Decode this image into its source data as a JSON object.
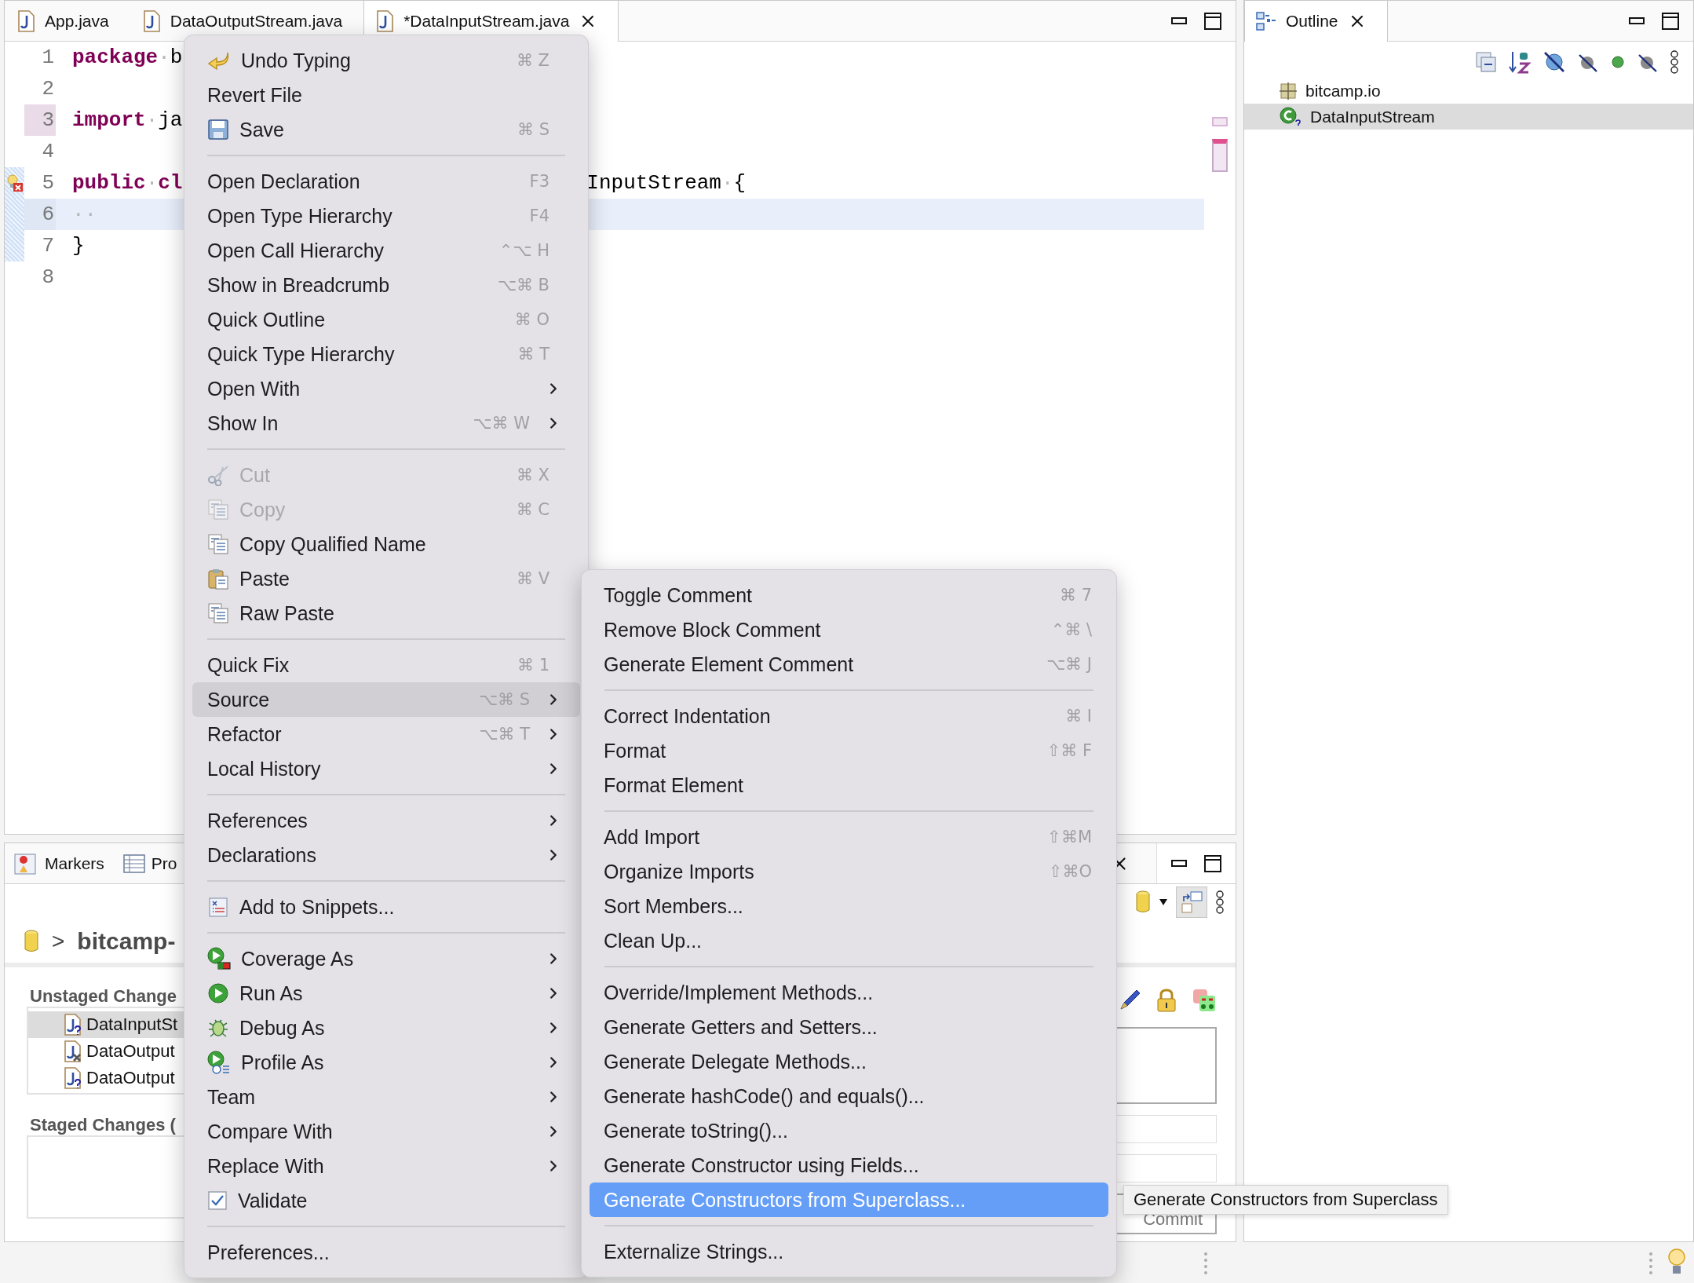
{
  "editor": {
    "tabs": [
      {
        "label": "App.java",
        "selected": false
      },
      {
        "label": "DataOutputStream.java",
        "selected": false
      },
      {
        "label": "*DataInputStream.java",
        "selected": true
      }
    ],
    "lines": [
      {
        "number": "1",
        "marked": false,
        "error": false,
        "changed": false,
        "current": false,
        "left": [
          {
            "kind": "keyword",
            "text": "package"
          },
          {
            "kind": "space",
            "text": "·"
          },
          {
            "kind": "plain",
            "text": "b"
          }
        ]
      },
      {
        "number": "2",
        "marked": false,
        "error": false,
        "changed": false,
        "current": false
      },
      {
        "number": "3",
        "marked": true,
        "error": false,
        "changed": false,
        "current": false,
        "left": [
          {
            "kind": "keyword",
            "text": "import"
          },
          {
            "kind": "space",
            "text": "·"
          },
          {
            "kind": "plain",
            "text": "ja"
          }
        ]
      },
      {
        "number": "4",
        "marked": false,
        "error": false,
        "changed": false,
        "current": false
      },
      {
        "number": "5",
        "marked": false,
        "error": true,
        "changed": true,
        "current": false,
        "left": [
          {
            "kind": "keyword",
            "text": "public"
          },
          {
            "kind": "space",
            "text": "·"
          },
          {
            "kind": "keyword",
            "text": "cl"
          }
        ],
        "right": [
          {
            "kind": "plain",
            "text": "InputStream"
          },
          {
            "kind": "space",
            "text": "·"
          },
          {
            "kind": "plain",
            "text": "{"
          }
        ]
      },
      {
        "number": "6",
        "marked": false,
        "error": false,
        "changed": true,
        "current": true,
        "left": [
          {
            "kind": "space",
            "text": "··"
          }
        ]
      },
      {
        "number": "7",
        "marked": false,
        "error": false,
        "changed": true,
        "current": false,
        "left": [
          {
            "kind": "plain",
            "text": "}"
          }
        ]
      },
      {
        "number": "8",
        "marked": false,
        "error": false,
        "changed": false,
        "current": false
      }
    ]
  },
  "outline": {
    "tab": "Outline",
    "items": [
      {
        "label": "bitcamp.io",
        "kind": "package",
        "selected": false
      },
      {
        "label": "DataInputStream",
        "kind": "class",
        "selected": true
      }
    ]
  },
  "bottom_panel": {
    "tabs": [
      {
        "label": "Markers"
      },
      {
        "label": "Pro"
      }
    ],
    "repository": {
      "arrow": ">",
      "name": "bitcamp-"
    },
    "unstaged": {
      "title": "Unstaged Change",
      "files": [
        {
          "name": "DataInputSt",
          "kind": "untracked",
          "selected": true
        },
        {
          "name": "DataOutput",
          "kind": "deleted",
          "selected": false
        },
        {
          "name": "DataOutput",
          "kind": "untracked",
          "selected": false
        }
      ]
    },
    "staged": {
      "title": "Staged Changes ("
    },
    "commit_button": "Commit"
  },
  "context_menu": {
    "groups": [
      [
        {
          "label": "Undo Typing",
          "shortcut": "⌘ Z",
          "submenu": false,
          "disabled": false,
          "selected": false
        },
        {
          "label": "Revert File",
          "submenu": false,
          "disabled": false,
          "selected": false
        },
        {
          "label": "Save",
          "shortcut": "⌘ S",
          "submenu": false,
          "disabled": false,
          "selected": false
        }
      ],
      [
        {
          "label": "Open Declaration",
          "shortcut": "F3",
          "submenu": false,
          "disabled": false,
          "selected": false
        },
        {
          "label": "Open Type Hierarchy",
          "shortcut": "F4",
          "submenu": false,
          "disabled": false,
          "selected": false
        },
        {
          "label": "Open Call Hierarchy",
          "shortcut": "⌃⌥ H",
          "submenu": false,
          "disabled": false,
          "selected": false
        },
        {
          "label": "Show in Breadcrumb",
          "shortcut": "⌥⌘ B",
          "submenu": false,
          "disabled": false,
          "selected": false
        },
        {
          "label": "Quick Outline",
          "shortcut": "⌘ O",
          "submenu": false,
          "disabled": false,
          "selected": false
        },
        {
          "label": "Quick Type Hierarchy",
          "shortcut": "⌘ T",
          "submenu": false,
          "disabled": false,
          "selected": false
        },
        {
          "label": "Open With",
          "submenu": true,
          "disabled": false,
          "selected": false
        },
        {
          "label": "Show In",
          "shortcut": "⌥⌘ W",
          "submenu": true,
          "disabled": false,
          "selected": false
        }
      ],
      [
        {
          "label": "Cut",
          "shortcut": "⌘ X",
          "submenu": false,
          "disabled": true,
          "selected": false
        },
        {
          "label": "Copy",
          "shortcut": "⌘ C",
          "submenu": false,
          "disabled": true,
          "selected": false
        },
        {
          "label": "Copy Qualified Name",
          "submenu": false,
          "disabled": false,
          "selected": false
        },
        {
          "label": "Paste",
          "shortcut": "⌘ V",
          "submenu": false,
          "disabled": false,
          "selected": false
        },
        {
          "label": "Raw Paste",
          "submenu": false,
          "disabled": false,
          "selected": false
        }
      ],
      [
        {
          "label": "Quick Fix",
          "shortcut": "⌘ 1",
          "submenu": false,
          "disabled": false,
          "selected": false
        },
        {
          "label": "Source",
          "shortcut": "⌥⌘ S",
          "submenu": true,
          "disabled": false,
          "selected": true
        },
        {
          "label": "Refactor",
          "shortcut": "⌥⌘ T",
          "submenu": true,
          "disabled": false,
          "selected": false
        },
        {
          "label": "Local History",
          "submenu": true,
          "disabled": false,
          "selected": false
        }
      ],
      [
        {
          "label": "References",
          "submenu": true,
          "disabled": false,
          "selected": false
        },
        {
          "label": "Declarations",
          "submenu": true,
          "disabled": false,
          "selected": false
        }
      ],
      [
        {
          "label": "Add to Snippets...",
          "submenu": false,
          "disabled": false,
          "selected": false
        }
      ],
      [
        {
          "label": "Coverage As",
          "submenu": true,
          "disabled": false,
          "selected": false
        },
        {
          "label": "Run As",
          "submenu": true,
          "disabled": false,
          "selected": false
        },
        {
          "label": "Debug As",
          "submenu": true,
          "disabled": false,
          "selected": false
        },
        {
          "label": "Profile As",
          "submenu": true,
          "disabled": false,
          "selected": false
        },
        {
          "label": "Team",
          "submenu": true,
          "disabled": false,
          "selected": false
        },
        {
          "label": "Compare With",
          "submenu": true,
          "disabled": false,
          "selected": false
        },
        {
          "label": "Replace With",
          "submenu": true,
          "disabled": false,
          "selected": false
        },
        {
          "label": "Validate",
          "submenu": false,
          "disabled": false,
          "selected": false
        }
      ],
      [
        {
          "label": "Preferences...",
          "submenu": false,
          "disabled": false,
          "selected": false
        }
      ]
    ]
  },
  "source_submenu": {
    "groups": [
      [
        {
          "label": "Toggle Comment",
          "shortcut": "⌘ 7",
          "selected": false
        },
        {
          "label": "Remove Block Comment",
          "shortcut": "⌃⌘ \\",
          "selected": false
        },
        {
          "label": "Generate Element Comment",
          "shortcut": "⌥⌘ J",
          "selected": false
        }
      ],
      [
        {
          "label": "Correct Indentation",
          "shortcut": "⌘ I",
          "selected": false
        },
        {
          "label": "Format",
          "shortcut": "⇧⌘ F",
          "selected": false
        },
        {
          "label": "Format Element",
          "selected": false
        }
      ],
      [
        {
          "label": "Add Import",
          "shortcut": "⇧⌘M",
          "selected": false
        },
        {
          "label": "Organize Imports",
          "shortcut": "⇧⌘O",
          "selected": false
        },
        {
          "label": "Sort Members...",
          "selected": false
        },
        {
          "label": "Clean Up...",
          "selected": false
        }
      ],
      [
        {
          "label": "Override/Implement Methods...",
          "selected": false
        },
        {
          "label": "Generate Getters and Setters...",
          "selected": false
        },
        {
          "label": "Generate Delegate Methods...",
          "selected": false
        },
        {
          "label": "Generate hashCode() and equals()...",
          "selected": false
        },
        {
          "label": "Generate toString()...",
          "selected": false
        },
        {
          "label": "Generate Constructor using Fields...",
          "selected": false
        },
        {
          "label": "Generate Constructors from Superclass...",
          "selected": true
        }
      ],
      [
        {
          "label": "Externalize Strings...",
          "selected": false
        }
      ]
    ]
  },
  "tooltip": "Generate Constructors from Superclass"
}
